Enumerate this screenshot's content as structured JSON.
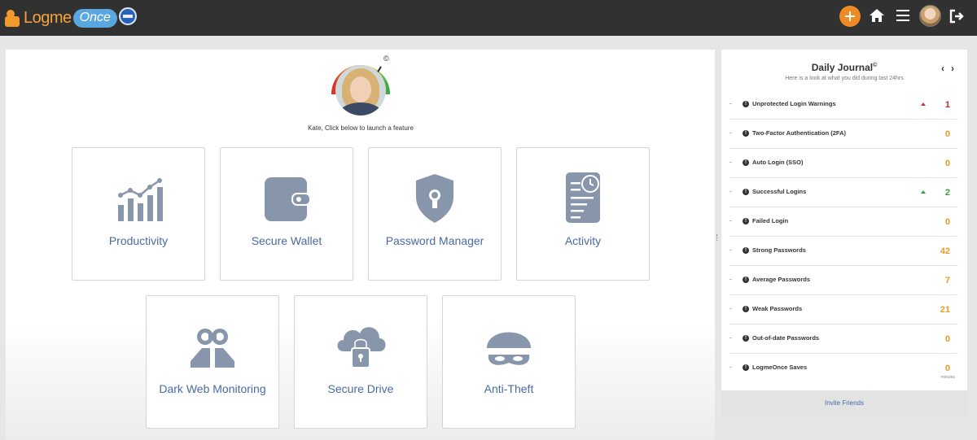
{
  "app": {
    "logo_text": "Logme",
    "logo_suffix": "Once"
  },
  "main": {
    "prompt": "Kate, Click below to launch a feature",
    "copyright": "©",
    "tiles": [
      {
        "label": "Productivity",
        "icon": "bar-chart-icon"
      },
      {
        "label": "Secure Wallet",
        "icon": "wallet-icon"
      },
      {
        "label": "Password Manager",
        "icon": "shield-lock-icon"
      },
      {
        "label": "Activity",
        "icon": "activity-log-icon"
      },
      {
        "label": "Dark Web Monitoring",
        "icon": "binoculars-icon"
      },
      {
        "label": "Secure Drive",
        "icon": "cloud-lock-icon"
      },
      {
        "label": "Anti-Theft",
        "icon": "thief-mask-icon"
      }
    ]
  },
  "journal": {
    "title": "Daily Journal",
    "title_mark": "©",
    "subtitle": "Here is a look at what you did during last 24hrs",
    "prev": "‹",
    "next": "›",
    "items": [
      {
        "label": "Unprotected Login Warnings",
        "value": "1",
        "trend": "up-red"
      },
      {
        "label": "Two-Factor Authentication (2FA)",
        "value": "0",
        "trend": ""
      },
      {
        "label": "Auto Login (SSO)",
        "value": "0",
        "trend": ""
      },
      {
        "label": "Successful Logins",
        "value": "2",
        "trend": "up-green"
      },
      {
        "label": "Failed Login",
        "value": "0",
        "trend": ""
      },
      {
        "label": "Strong Passwords",
        "value": "42",
        "trend": ""
      },
      {
        "label": "Average Passwords",
        "value": "7",
        "trend": ""
      },
      {
        "label": "Weak Passwords",
        "value": "21",
        "trend": ""
      },
      {
        "label": "Out-of-date Passwords",
        "value": "0",
        "trend": ""
      },
      {
        "label": "LogmeOnce Saves",
        "value": "0",
        "trend": "",
        "unit": "minutes"
      }
    ],
    "footer": "Invite Friends"
  },
  "colors": {
    "topbar": "#313131",
    "accent_orange": "#f08a24",
    "tile_label": "#4a6aa3",
    "icon_gray": "#8796aa"
  }
}
